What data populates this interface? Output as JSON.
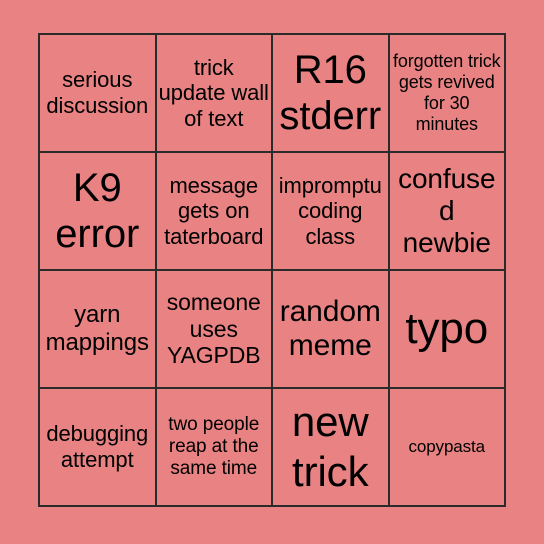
{
  "card": {
    "background_color": "#e98282",
    "border_color": "#2b2b2b",
    "text_color": "#000000",
    "rows": 4,
    "columns": 4,
    "cells": [
      {
        "text": "serious discussion",
        "size_class": "fs-22"
      },
      {
        "text": "trick update wall of text",
        "size_class": "fs-22"
      },
      {
        "text": "R16 stderr",
        "size_class": "fs-40"
      },
      {
        "text": "forgotten trick gets revived for 30 minutes",
        "size_class": "fs-18"
      },
      {
        "text": "K9 error",
        "size_class": "fs-40"
      },
      {
        "text": "message gets on taterboard",
        "size_class": "fs-22"
      },
      {
        "text": "impromptu coding class",
        "size_class": "fs-22"
      },
      {
        "text": "confused newbie",
        "size_class": "fs-28"
      },
      {
        "text": "yarn mappings",
        "size_class": "fs-24"
      },
      {
        "text": "someone uses YAGPDB",
        "size_class": "fs-23"
      },
      {
        "text": "random meme",
        "size_class": "fs-30"
      },
      {
        "text": "typo",
        "size_class": "fs-44"
      },
      {
        "text": "debugging attempt",
        "size_class": "fs-22"
      },
      {
        "text": "two people reap at the same time",
        "size_class": "fs-19"
      },
      {
        "text": "new trick",
        "size_class": "fs-42"
      },
      {
        "text": "copypasta",
        "size_class": "fs-17"
      }
    ]
  }
}
